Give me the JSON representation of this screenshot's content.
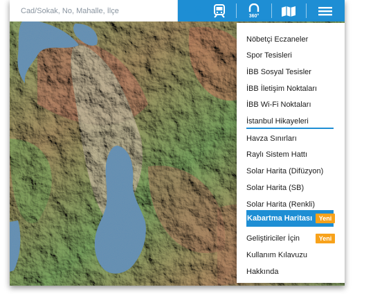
{
  "search": {
    "placeholder": "Cad/Sokak, No, Mahalle, İlçe"
  },
  "toolbar": {
    "icons": [
      "search-icon",
      "chevron-double-down-icon",
      "train-icon",
      "panorama-360-icon",
      "book-map-icon",
      "menu-icon"
    ],
    "panorama_label": "360°"
  },
  "menu": {
    "items": [
      {
        "label": "Nöbetçi Eczaneler"
      },
      {
        "label": "Spor Tesisleri"
      },
      {
        "label": "İBB Sosyal Tesisler"
      },
      {
        "label": "İBB İletişim Noktaları"
      },
      {
        "label": "İBB Wi-Fi Noktaları"
      },
      {
        "label": "İstanbul Hikayeleri"
      },
      {
        "label": "Havza Sınırları"
      },
      {
        "label": "Raylı Sistem Hattı"
      },
      {
        "label": "Solar Harita (Difüzyon)"
      },
      {
        "label": "Solar Harita (SB)"
      },
      {
        "label": "Solar Harita (Renkli)"
      },
      {
        "label": "Kabartma Haritası",
        "badge": "Yeni",
        "active": true
      },
      {
        "label": "Geliştiriciler İçin",
        "badge": "Yeni"
      },
      {
        "label": "Kullanım Kılavuzu"
      },
      {
        "label": "Hakkında"
      }
    ]
  },
  "colors": {
    "accent": "#1e8ed4",
    "badge": "#f7a21b",
    "water": "#5f8db4"
  }
}
